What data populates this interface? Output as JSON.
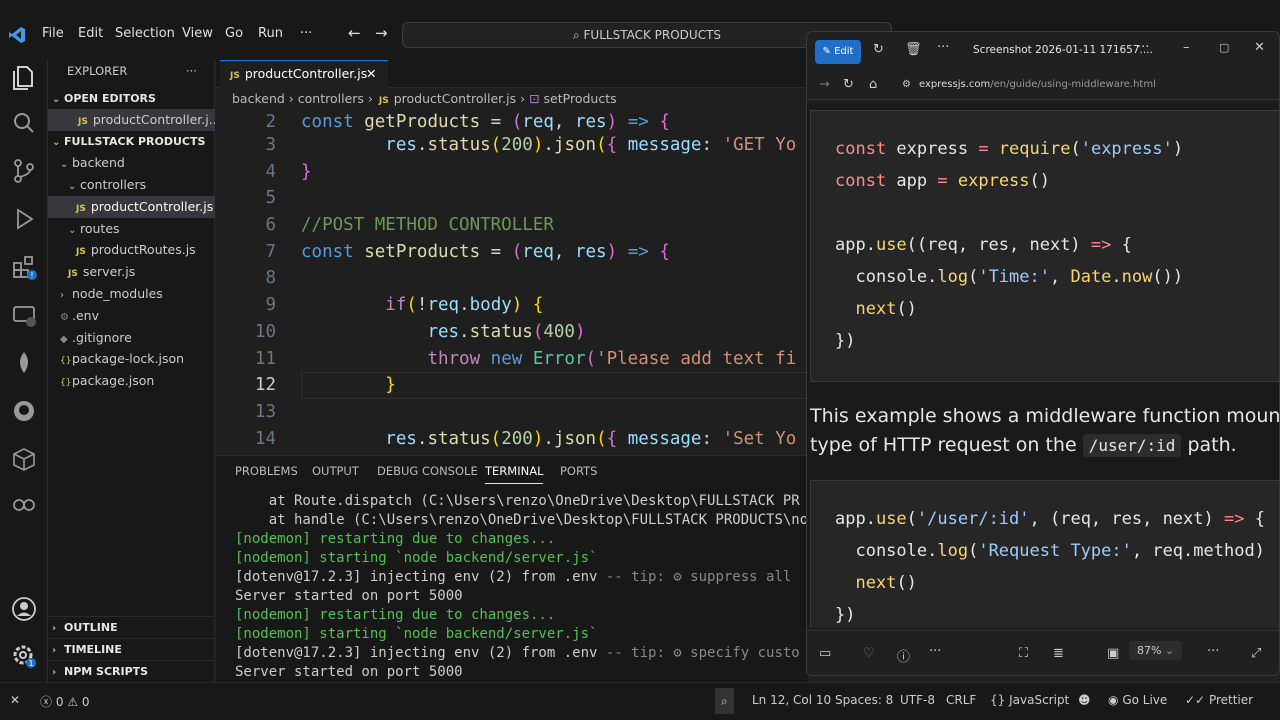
{
  "menu": {
    "file": "File",
    "edit": "Edit",
    "selection": "Selection",
    "view": "View",
    "go": "Go",
    "run": "Run",
    "more": "···"
  },
  "command_center": "FULLSTACK PRODUCTS",
  "explorer": {
    "title": "EXPLORER",
    "open_editors": "OPEN EDITORS",
    "open_editor_file": "productController.j...",
    "project": "FULLSTACK PRODUCTS",
    "tree": [
      {
        "label": "backend",
        "type": "folder"
      },
      {
        "label": "controllers",
        "type": "folder"
      },
      {
        "label": "productController.js",
        "type": "js"
      },
      {
        "label": "routes",
        "type": "folder"
      },
      {
        "label": "productRoutes.js",
        "type": "js"
      },
      {
        "label": "server.js",
        "type": "js"
      },
      {
        "label": "node_modules",
        "type": "folder"
      },
      {
        "label": ".env",
        "type": "env"
      },
      {
        "label": ".gitignore",
        "type": "git"
      },
      {
        "label": "package-lock.json",
        "type": "json"
      },
      {
        "label": "package.json",
        "type": "json"
      }
    ],
    "outline": "OUTLINE",
    "timeline": "TIMELINE",
    "npm_scripts": "NPM SCRIPTS"
  },
  "tab": {
    "label": "productController.js",
    "js": "JS"
  },
  "breadcrumb": {
    "b1": "backend",
    "b2": "controllers",
    "b3": "productController.js",
    "b4": "setProducts"
  },
  "line_numbers": [
    "2",
    "3",
    "4",
    "5",
    "6",
    "7",
    "8",
    "9",
    "10",
    "11",
    "12",
    "13",
    "14"
  ],
  "panel": {
    "problems": "PROBLEMS",
    "output": "OUTPUT",
    "debug": "DEBUG CONSOLE",
    "terminal": "TERMINAL",
    "ports": "PORTS"
  },
  "terminal": [
    "    at Route.dispatch (C:\\Users\\renzo\\OneDrive\\Desktop\\FULLSTACK PR",
    "    at handle (C:\\Users\\renzo\\OneDrive\\Desktop\\FULLSTACK PRODUCTS\\no",
    "[nodemon] restarting due to changes...",
    "[nodemon] starting `node backend/server.js`",
    "[dotenv@17.2.3] injecting env (2) from .env",
    "-- tip: ⚙ suppress all",
    "Server started on port 5000",
    "[nodemon] restarting due to changes...",
    "[nodemon] starting `node backend/server.js`",
    "[dotenv@17.2.3] injecting env (2) from .env",
    "-- tip: ⚙ specify custo",
    "Server started on port 5000"
  ],
  "status": {
    "errors": "0",
    "warnings": "0",
    "position": "Ln 12, Col 10",
    "spaces": "Spaces: 8",
    "encoding": "UTF-8",
    "eol": "CRLF",
    "language": "JavaScript",
    "golive": "Go Live",
    "prettier": "Prettier"
  },
  "viewer": {
    "edit": "Edit",
    "title": "Screenshot 2026-01-11 171657....",
    "url": "expressjs.com/en/guide/using-middleware.html",
    "url_host": "expressjs.com",
    "url_path": "/en/guide/using-middleware.html",
    "para1": "This example shows a middleware function mount",
    "para2a": "type of HTTP request on the",
    "para2code": "/user/:id",
    "para2b": "path.",
    "zoom": "87%"
  },
  "colors": {
    "accent": "#0078d4",
    "bg": "#1f1f1f"
  }
}
